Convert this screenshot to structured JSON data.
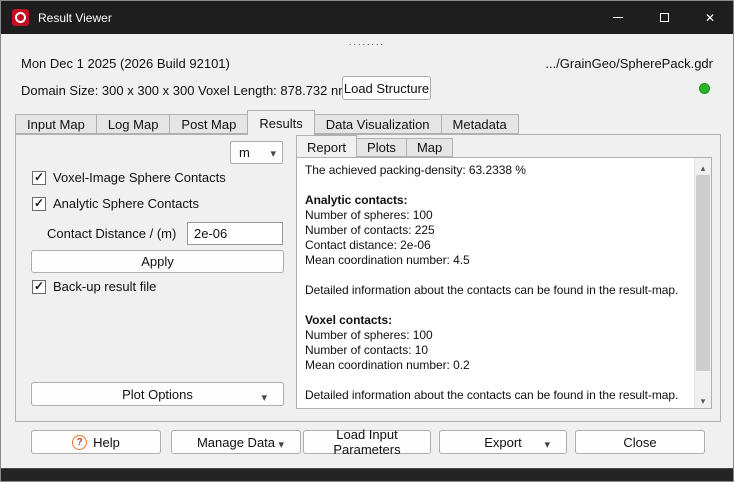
{
  "window": {
    "title": "Result Viewer",
    "drag_dots": "........"
  },
  "header": {
    "build_info": "Mon Dec 1 2025 (2026 Build 92101)",
    "file_path": ".../GrainGeo/SpherePack.gdr",
    "domain_size": "Domain Size: 300 x 300 x 300",
    "voxel_length": "Voxel Length: 878.732 nm",
    "load_structure": "Load Structure",
    "status_color": "#28b428"
  },
  "tabs": [
    {
      "label": "Input Map",
      "active": false
    },
    {
      "label": "Log Map",
      "active": false
    },
    {
      "label": "Post Map",
      "active": false
    },
    {
      "label": "Results",
      "active": true
    },
    {
      "label": "Data Visualization",
      "active": false
    },
    {
      "label": "Metadata",
      "active": false
    }
  ],
  "results_tab": {
    "unit_select": {
      "value": "m"
    },
    "checkboxes": [
      {
        "label": "Voxel-Image Sphere Contacts",
        "checked": true
      },
      {
        "label": "Analytic Sphere Contacts",
        "checked": true
      }
    ],
    "contact_distance": {
      "label": "Contact Distance / (m)",
      "value": "2e-06"
    },
    "apply_button": "Apply",
    "backup_checkbox": {
      "label": "Back-up result file",
      "checked": true
    },
    "plot_options_button": "Plot Options",
    "subtabs": [
      {
        "label": "Report",
        "active": true
      },
      {
        "label": "Plots",
        "active": false
      },
      {
        "label": "Map",
        "active": false
      }
    ],
    "report_lines": [
      {
        "text": "The achieved packing-density: 63.2338 %"
      },
      {
        "text": ""
      },
      {
        "text": "Analytic contacts:",
        "bold": true
      },
      {
        "text": "Number of spheres: 100"
      },
      {
        "text": "Number of contacts: 225"
      },
      {
        "text": "Contact distance: 2e-06"
      },
      {
        "text": "Mean coordination number: 4.5"
      },
      {
        "text": ""
      },
      {
        "text": "Detailed information about the contacts can be found in the result-map."
      },
      {
        "text": ""
      },
      {
        "text": "Voxel contacts:",
        "bold": true
      },
      {
        "text": "Number of spheres: 100"
      },
      {
        "text": "Number of contacts: 10"
      },
      {
        "text": "Mean coordination number: 0.2"
      },
      {
        "text": ""
      },
      {
        "text": "Detailed information about the contacts can be found in the result-map."
      }
    ]
  },
  "footer": {
    "help": "Help",
    "manage_data": "Manage Data",
    "load_input_parameters": "Load Input Parameters",
    "export": "Export",
    "close": "Close"
  }
}
